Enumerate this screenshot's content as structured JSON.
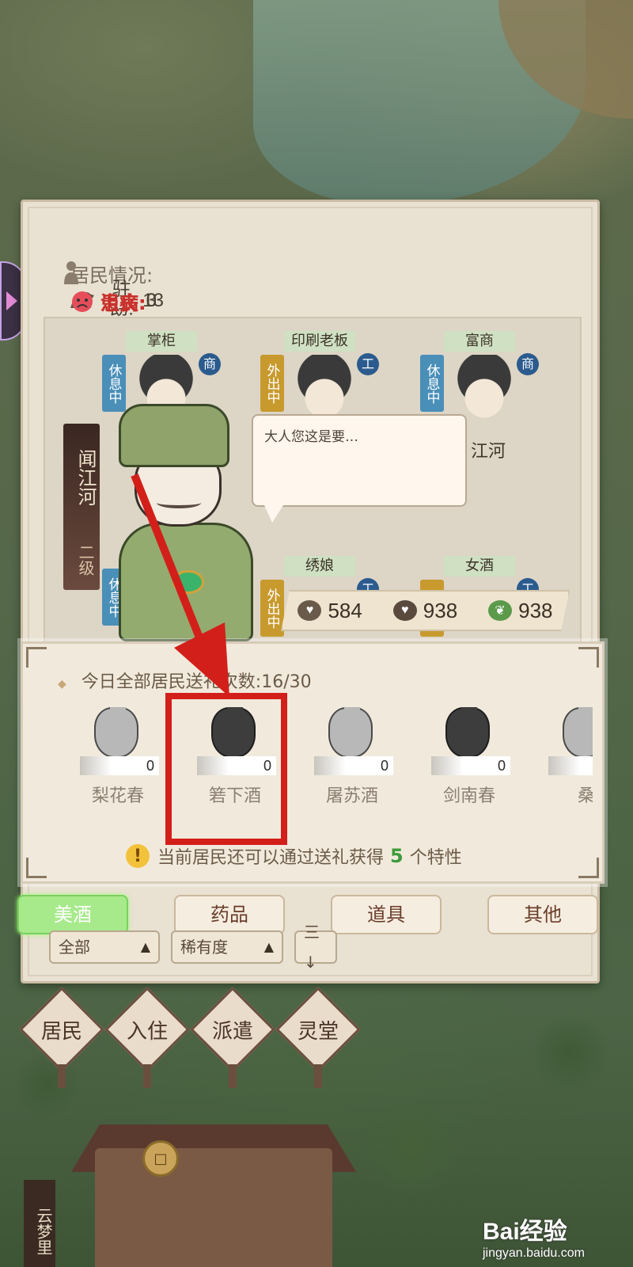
{
  "status": {
    "label": "居民情况:",
    "stay_label": "驻留:",
    "stay_count": "13",
    "sick_label": "患病:",
    "sick_count": "3",
    "depressed_label": "沮丧:",
    "depressed_count": "0"
  },
  "residents": [
    {
      "role": "掌柜",
      "state": "休息中",
      "state_type": "rest",
      "type": "商"
    },
    {
      "role": "印刷老板",
      "state": "外出中",
      "state_type": "out",
      "type": "工"
    },
    {
      "role": "富商",
      "state": "休息中",
      "state_type": "rest",
      "type": "商",
      "name": "江河"
    },
    {
      "role": "绣娘",
      "state": "外出中",
      "state_type": "out",
      "type": "工"
    },
    {
      "role": "女酒",
      "state": "外",
      "state_type": "out",
      "type": "工"
    }
  ],
  "selected_resident": {
    "name": "闻江河",
    "level": "二级",
    "row_state": "休息中"
  },
  "speech": "大人您这是要…",
  "stats": {
    "a": "584",
    "b": "938",
    "c": "938"
  },
  "gift": {
    "count_label": "今日全部居民送礼次数:16/30",
    "items": [
      {
        "name": "梨花春",
        "qty": "0",
        "jar": "light"
      },
      {
        "name": "箬下酒",
        "qty": "0",
        "jar": "dark"
      },
      {
        "name": "屠苏酒",
        "qty": "0",
        "jar": "light"
      },
      {
        "name": "剑南春",
        "qty": "0",
        "jar": "dark"
      },
      {
        "name": "桑",
        "qty": "",
        "jar": "light"
      }
    ],
    "trait_prefix": "当前居民还可以通过送礼获得",
    "trait_num": "5",
    "trait_suffix": "个特性"
  },
  "tabs": [
    "美酒",
    "药品",
    "道具",
    "其他"
  ],
  "filters": {
    "all": "全部",
    "rarity": "稀有度",
    "sort_icon": "三↓"
  },
  "nav": [
    "居民",
    "入住",
    "派遣",
    "灵堂"
  ],
  "bottom_label": "云梦里",
  "watermark": {
    "main": "Bai经验",
    "url": "jingyan.baidu.com"
  },
  "colors": {
    "highlight": "#d31f1a",
    "active_tab": "#a7ea8b",
    "sick": "#c9302c",
    "trait_num": "#3e9a3a"
  }
}
